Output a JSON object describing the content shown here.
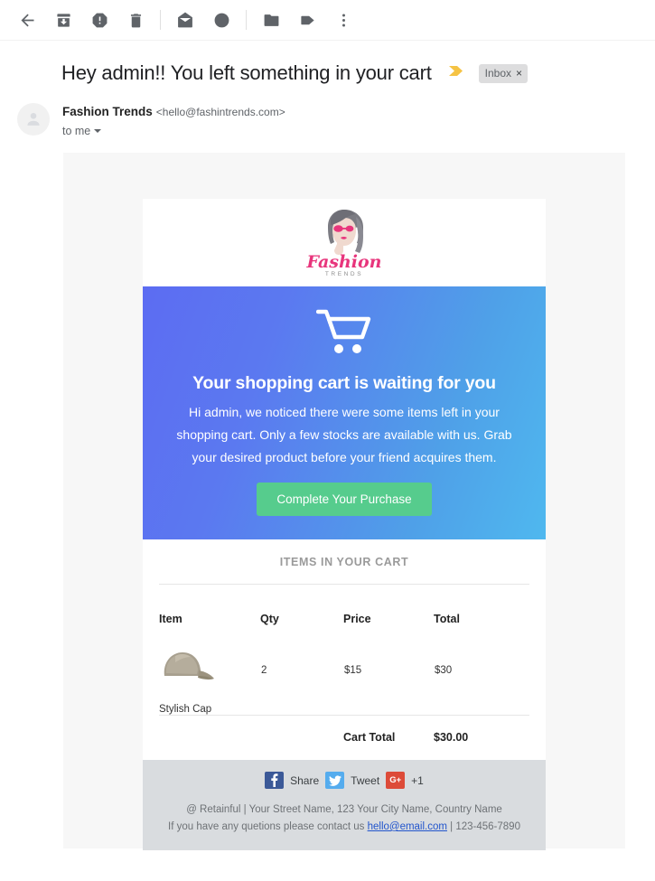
{
  "toolbar": {
    "buttons": [
      {
        "name": "back-icon",
        "label": "Back"
      },
      {
        "name": "archive-icon",
        "label": "Archive"
      },
      {
        "name": "report-spam-icon",
        "label": "Report spam"
      },
      {
        "name": "delete-icon",
        "label": "Delete"
      },
      {
        "name": "mark-unread-icon",
        "label": "Mark as unread"
      },
      {
        "name": "snooze-clock-icon",
        "label": "Snooze"
      },
      {
        "name": "move-to-icon",
        "label": "Move to"
      },
      {
        "name": "label-tag-icon",
        "label": "Labels"
      },
      {
        "name": "more-options-icon",
        "label": "More"
      }
    ]
  },
  "email": {
    "subject": "Hey admin!! You left something in your cart",
    "label_chip": "Inbox",
    "label_chip_close": "×",
    "sender_name": "Fashion Trends",
    "sender_email": "<hello@fashintrends.com>",
    "recipient": "to me"
  },
  "message": {
    "logo": {
      "word": "Fashion",
      "subword": "TRENDS",
      "pink": "#e8357c",
      "gray": "#8d8d8d"
    },
    "hero": {
      "icon": "shopping-cart-icon",
      "title": "Your shopping cart is waiting for you",
      "body": "Hi admin, we noticed there were some items left in your shopping cart. Only a few stocks are available with us. Grab your desired product before your friend acquires them.",
      "cta_label": "Complete Your Purchase",
      "cta_color": "#56cc8d",
      "gradient_from": "#5c6cf2",
      "gradient_to": "#4fb8ef"
    },
    "cart": {
      "section_title": "ITEMS IN YOUR CART",
      "columns": [
        "Item",
        "Qty",
        "Price",
        "Total"
      ],
      "rows": [
        {
          "image": "stylish-cap-image",
          "name": "Stylish Cap",
          "qty": "2",
          "price": "$15",
          "total": "$30"
        }
      ],
      "total_label": "Cart Total",
      "total_value": "$30.00"
    },
    "footer": {
      "social": [
        {
          "name": "facebook-share-button",
          "glyph": "f",
          "label": "Share",
          "color": "#3b5998"
        },
        {
          "name": "twitter-tweet-button",
          "glyph": "t",
          "label": "Tweet",
          "color": "#55acee"
        },
        {
          "name": "googleplus-plusone-button",
          "glyph": "G+",
          "label": "+1",
          "color": "#dd4b39"
        }
      ],
      "address": "@ Retainful | Your Street Name, 123 Your City Name, Country Name",
      "contact_prefix": "If you have any quetions please contact us",
      "contact_email": "hello@email.com",
      "contact_phone": "| 123-456-7890"
    }
  }
}
